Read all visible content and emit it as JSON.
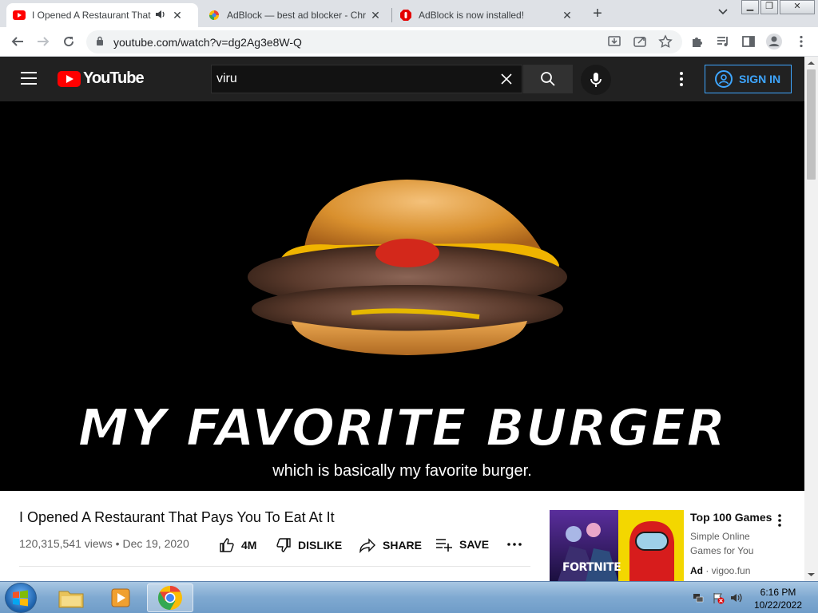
{
  "browser": {
    "tabs": [
      {
        "title": "I Opened A Restaurant That Pays You To Eat At It - YouTube",
        "active": true,
        "audio": true
      },
      {
        "title": "AdBlock — best ad blocker - Chrome Web Store",
        "active": false
      },
      {
        "title": "AdBlock is now installed!",
        "active": false
      }
    ],
    "url": "youtube.com/watch?v=dg2Ag3e8W-Q"
  },
  "youtube": {
    "logo": "YouTube",
    "search_value": "viru",
    "sign_in": "SIGN IN",
    "video": {
      "overlay_title": "MY FAVORITE BURGER",
      "subtitle": "which is basically my favorite burger.",
      "title": "I Opened A Restaurant That Pays You To Eat At It",
      "views": "120,315,541 views",
      "date": "Dec 19, 2020",
      "likes": "4M",
      "dislike": "DISLIKE",
      "share": "SHARE",
      "save": "SAVE"
    },
    "ad": {
      "title": "Top 100 Games",
      "description": "Simple Online Games for You",
      "label": "Ad",
      "domain": "vigoo.fun",
      "image_text": "FORTNITE"
    }
  },
  "taskbar": {
    "time": "6:16 PM",
    "date": "10/22/2022"
  },
  "colors": {
    "yt_red": "#ff0000",
    "signin_blue": "#3ea6ff",
    "header_bg": "#212121"
  }
}
